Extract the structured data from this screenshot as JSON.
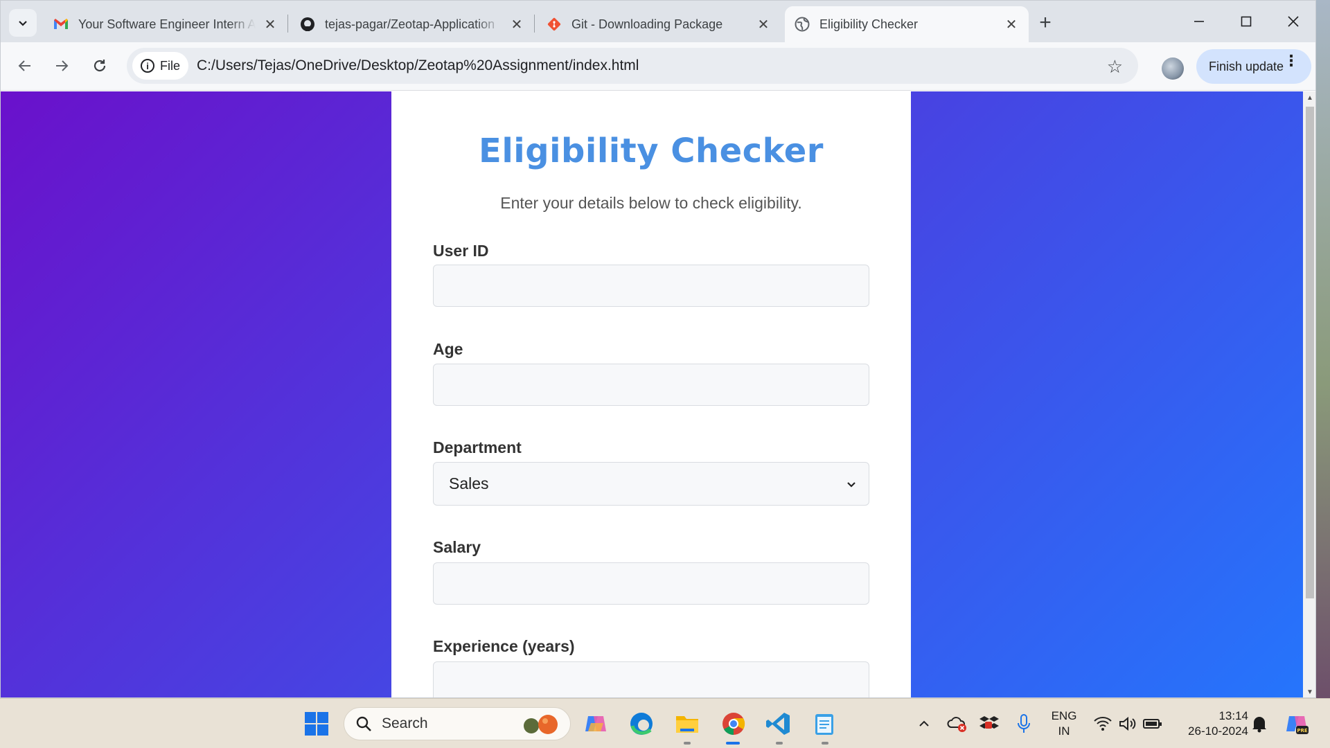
{
  "browser": {
    "tabs": [
      {
        "title": "Your Software Engineer Intern A",
        "icon": "gmail-icon",
        "active": false
      },
      {
        "title": "tejas-pagar/Zeotap-Application",
        "icon": "github-icon",
        "active": false
      },
      {
        "title": "Git - Downloading Package",
        "icon": "git-icon",
        "active": false
      },
      {
        "title": "Eligibility Checker",
        "icon": "globe-icon",
        "active": true
      }
    ],
    "address": {
      "chip_label": "File",
      "url": "C:/Users/Tejas/OneDrive/Desktop/Zeotap%20Assignment/index.html"
    },
    "update_button_label": "Finish update"
  },
  "page": {
    "title": "Eligibility Checker",
    "subtitle": "Enter your details below to check eligibility.",
    "fields": {
      "user_id": {
        "label": "User ID",
        "value": ""
      },
      "age": {
        "label": "Age",
        "value": ""
      },
      "department": {
        "label": "Department",
        "selected": "Sales"
      },
      "salary": {
        "label": "Salary",
        "value": ""
      },
      "experience": {
        "label": "Experience (years)",
        "value": ""
      }
    },
    "background_gradient": [
      "#6a11cb",
      "#2575fc"
    ],
    "accent_color": "#4a90e2"
  },
  "taskbar": {
    "search_label": "Search",
    "tray": {
      "language_line1": "ENG",
      "language_line2": "IN",
      "time": "13:14",
      "date": "26-10-2024"
    },
    "apps": [
      "windows-start-icon",
      "copilot-icon",
      "edge-icon",
      "file-explorer-icon",
      "chrome-icon",
      "vscode-icon",
      "notepad-icon"
    ]
  }
}
